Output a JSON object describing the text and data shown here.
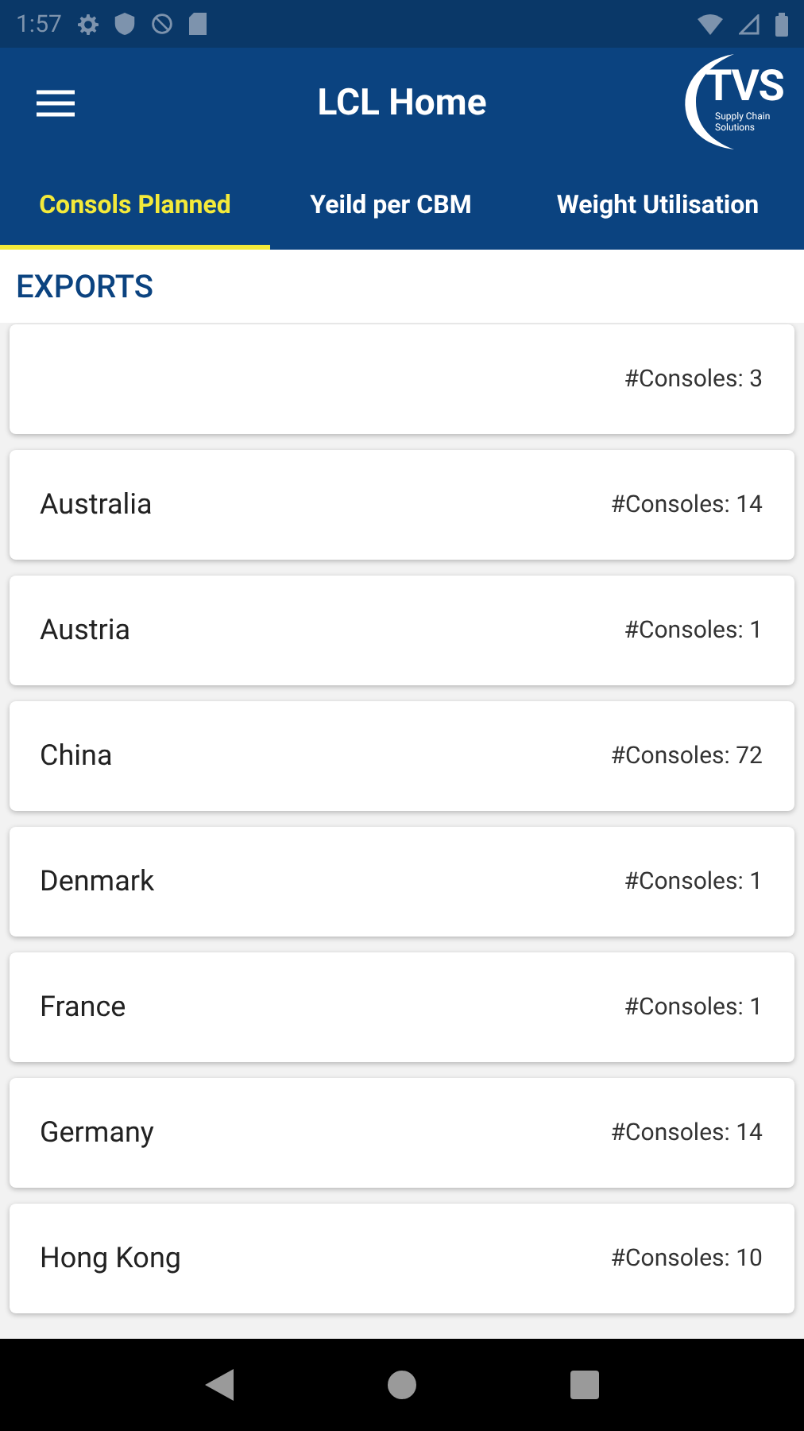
{
  "status_bar": {
    "time": "1:57"
  },
  "app_bar": {
    "title": "LCL Home",
    "logo": {
      "name": "TVS",
      "tagline": "Supply Chain Solutions"
    }
  },
  "tabs": [
    {
      "label": "Consols Planned",
      "selected": true
    },
    {
      "label": "Yeild per CBM",
      "selected": false
    },
    {
      "label": "Weight Utilisation",
      "selected": false
    }
  ],
  "section": "EXPORTS",
  "rows": [
    {
      "count": "#Consoles: 3"
    },
    {
      "country": "Australia",
      "count": "#Consoles: 14"
    },
    {
      "country": "Austria",
      "count": "#Consoles: 1"
    },
    {
      "country": "China",
      "count": "#Consoles: 72"
    },
    {
      "country": "Denmark",
      "count": "#Consoles: 1"
    },
    {
      "country": "France",
      "count": "#Consoles: 1"
    },
    {
      "country": "Germany",
      "count": "#Consoles: 14"
    },
    {
      "country": "Hong Kong",
      "count": "#Consoles: 10"
    }
  ]
}
